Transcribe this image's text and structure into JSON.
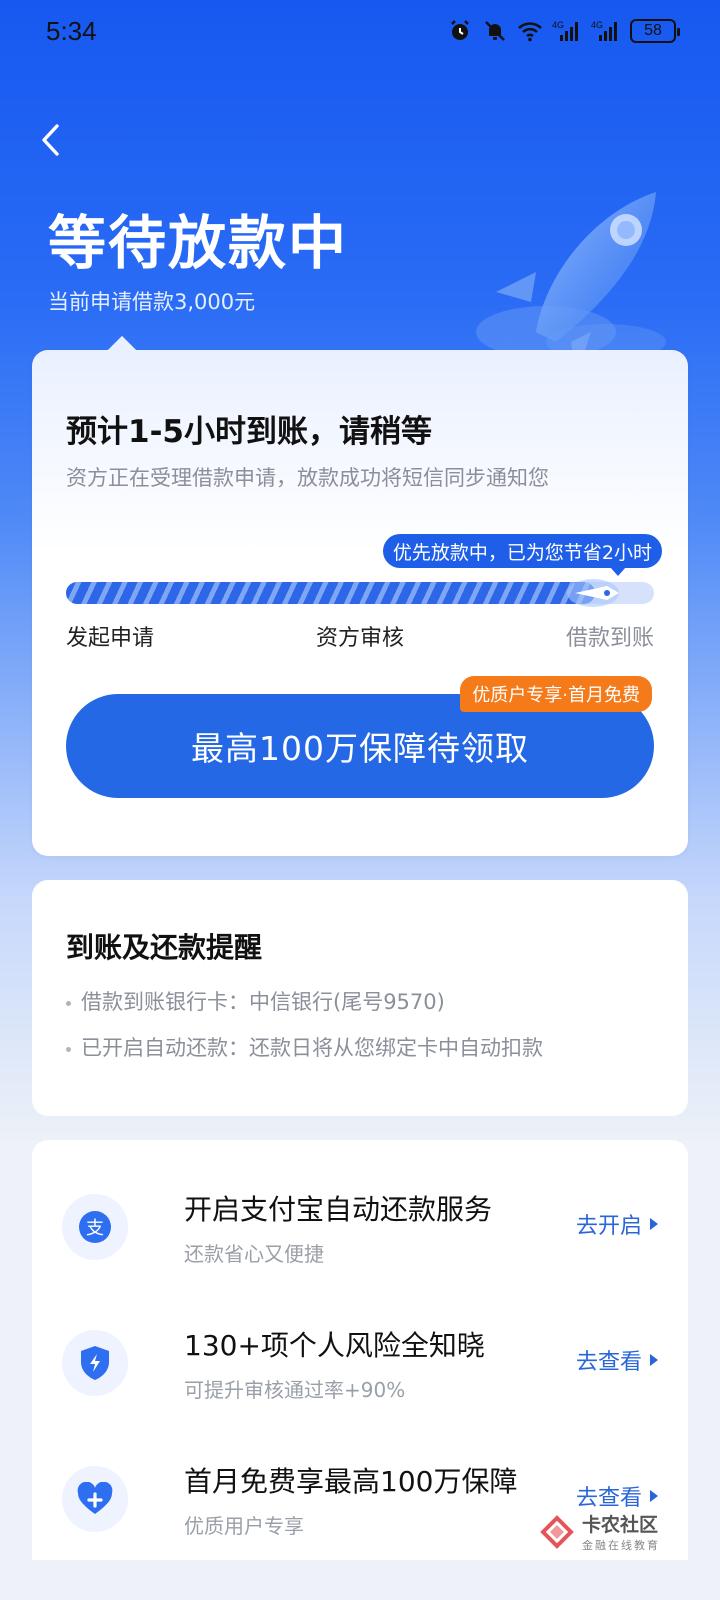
{
  "status_bar": {
    "time": "5:34",
    "battery": "58",
    "network_1": "4G",
    "network_2": "4G"
  },
  "header": {
    "title": "等待放款中",
    "subtitle": "当前申请借款3,000元"
  },
  "progress_card": {
    "title": "预计1-5小时到账，请稍等",
    "description": "资方正在受理借款申请，放款成功将短信同步通知您",
    "priority_badge": "优先放款中，已为您节省2小时",
    "progress_fraction": 0.9,
    "steps": [
      "发起申请",
      "资方审核",
      "借款到账"
    ],
    "cta_label": "最高100万保障待领取",
    "cta_badge": "优质户专享·首月免费"
  },
  "reminder_card": {
    "title": "到账及还款提醒",
    "lines": [
      "借款到账银行卡：中信银行(尾号9570)",
      "已开启自动还款：还款日将从您绑定卡中自动扣款"
    ]
  },
  "services": [
    {
      "icon": "alipay-icon",
      "title": "开启支付宝自动还款服务",
      "subtitle": "还款省心又便捷",
      "action": "去开启"
    },
    {
      "icon": "shield-icon",
      "title": "130+项个人风险全知晓",
      "subtitle": "可提升审核通过率+90%",
      "action": "去查看"
    },
    {
      "icon": "heart-plus-icon",
      "title": "首月免费享最高100万保障",
      "subtitle": "优质用户专享",
      "action": "去查看"
    }
  ],
  "watermark": {
    "name": "卡农社区",
    "tagline": "金融在线教育"
  },
  "colors": {
    "primary": "#2468e6",
    "accent_orange": "#f57a1a",
    "header_blue": "#1758f0"
  }
}
